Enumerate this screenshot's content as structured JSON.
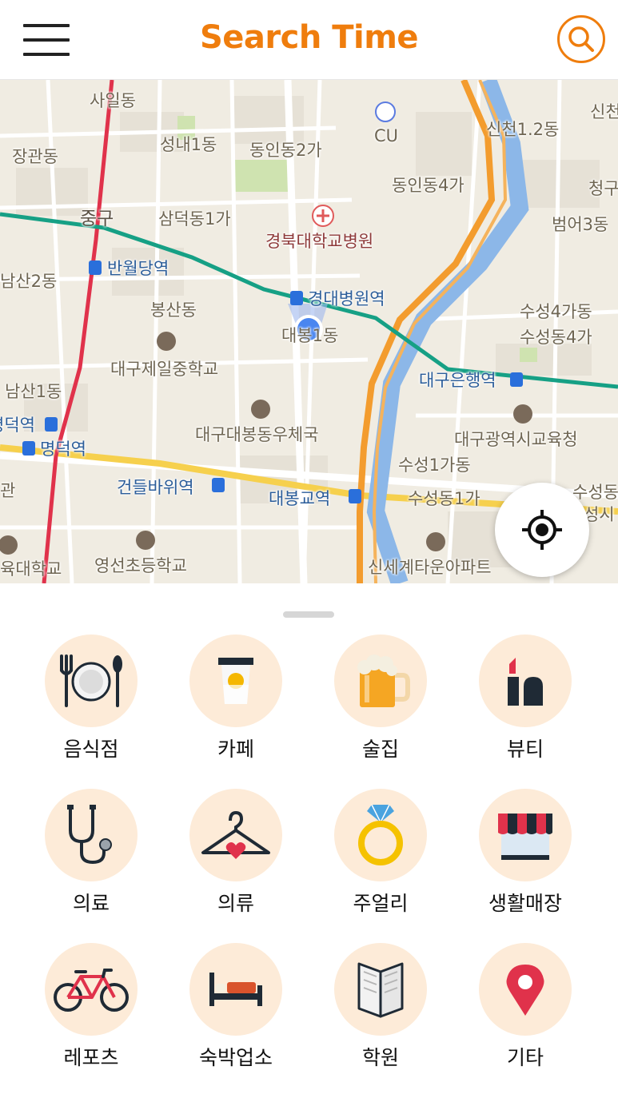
{
  "header": {
    "title": "Search Time",
    "accent_color": "#ef7d0d",
    "menu_icon": "hamburger-menu-icon",
    "search_icon": "search-icon"
  },
  "map": {
    "labels": {
      "sail": "사일동",
      "janggwan": "장관동",
      "seongnae1": "성내1동",
      "dongin2": "동인동2가",
      "cu": "CU",
      "sincheon12": "신천1.2동",
      "sincheon": "신천",
      "dongin4": "동인동4가",
      "cheonggu": "청구",
      "junggu": "중구",
      "samdeok1": "삼덕동1가",
      "knuh": "경북대학교병원",
      "beomeo3": "범어3동",
      "namsan2": "남산2동",
      "banwoldang": "반월당역",
      "kyungdae_station": "경대병원역",
      "bongsan": "봉산동",
      "daebong1": "대봉1동",
      "suseong4ga": "수성4가동",
      "suseongdong4ga": "수성동4가",
      "daegu_jeil": "대구제일중학교",
      "daegu_bank_station": "대구은행역",
      "namsan1": "남산1동",
      "myeongdeok_left": "명덕역",
      "myeongdeok": "명덕역",
      "daebong_post": "대구대봉동우체국",
      "edu_office": "대구광역시교육청",
      "gwan": "관",
      "suseong1ga_dong": "수성1가동",
      "geondeulbawi": "건들바위역",
      "daebonggyo": "대봉교역",
      "suseongdong1ga": "수성동1가",
      "suseong_right": "수성동",
      "suseong_si": "성시",
      "edu_univ": "육대학교",
      "yeongseon": "영선초등학교",
      "shinsegae": "신세계타운아파트"
    },
    "locate_icon": "my-location-icon"
  },
  "categories": [
    {
      "label": "음식점",
      "icon": "restaurant-plate-icon"
    },
    {
      "label": "카페",
      "icon": "coffee-cup-icon"
    },
    {
      "label": "술집",
      "icon": "beer-mug-icon"
    },
    {
      "label": "뷰티",
      "icon": "cosmetics-icon"
    },
    {
      "label": "의료",
      "icon": "stethoscope-icon"
    },
    {
      "label": "의류",
      "icon": "clothes-hanger-icon"
    },
    {
      "label": "주얼리",
      "icon": "diamond-ring-icon"
    },
    {
      "label": "생활매장",
      "icon": "store-awning-icon"
    },
    {
      "label": "레포츠",
      "icon": "bicycle-icon"
    },
    {
      "label": "숙박업소",
      "icon": "bed-icon"
    },
    {
      "label": "학원",
      "icon": "open-book-icon"
    },
    {
      "label": "기타",
      "icon": "map-pin-icon"
    }
  ]
}
